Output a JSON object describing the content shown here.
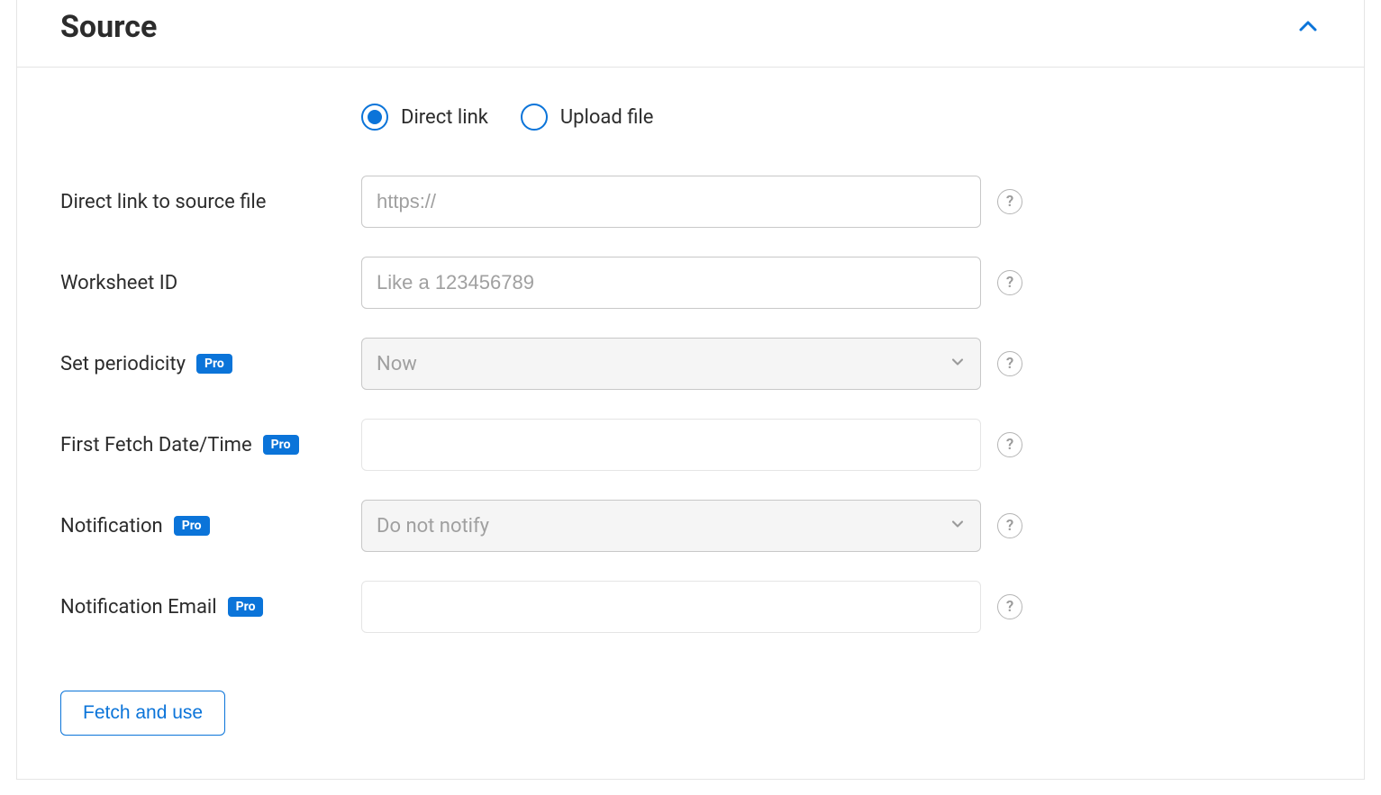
{
  "panel": {
    "title": "Source"
  },
  "source_type": {
    "direct_link_label": "Direct link",
    "upload_file_label": "Upload file",
    "selected": "direct_link"
  },
  "fields": {
    "direct_link": {
      "label": "Direct link to source file",
      "placeholder": "https://",
      "value": ""
    },
    "worksheet_id": {
      "label": "Worksheet ID",
      "placeholder": "Like a 123456789",
      "value": ""
    },
    "periodicity": {
      "label": "Set periodicity",
      "pro_badge": "Pro",
      "value": "Now"
    },
    "first_fetch": {
      "label": "First Fetch Date/Time",
      "pro_badge": "Pro",
      "value": ""
    },
    "notification": {
      "label": "Notification",
      "pro_badge": "Pro",
      "value": "Do not notify"
    },
    "notification_email": {
      "label": "Notification Email",
      "pro_badge": "Pro",
      "value": ""
    }
  },
  "actions": {
    "fetch_button": "Fetch and use"
  },
  "help_tooltip": "?"
}
